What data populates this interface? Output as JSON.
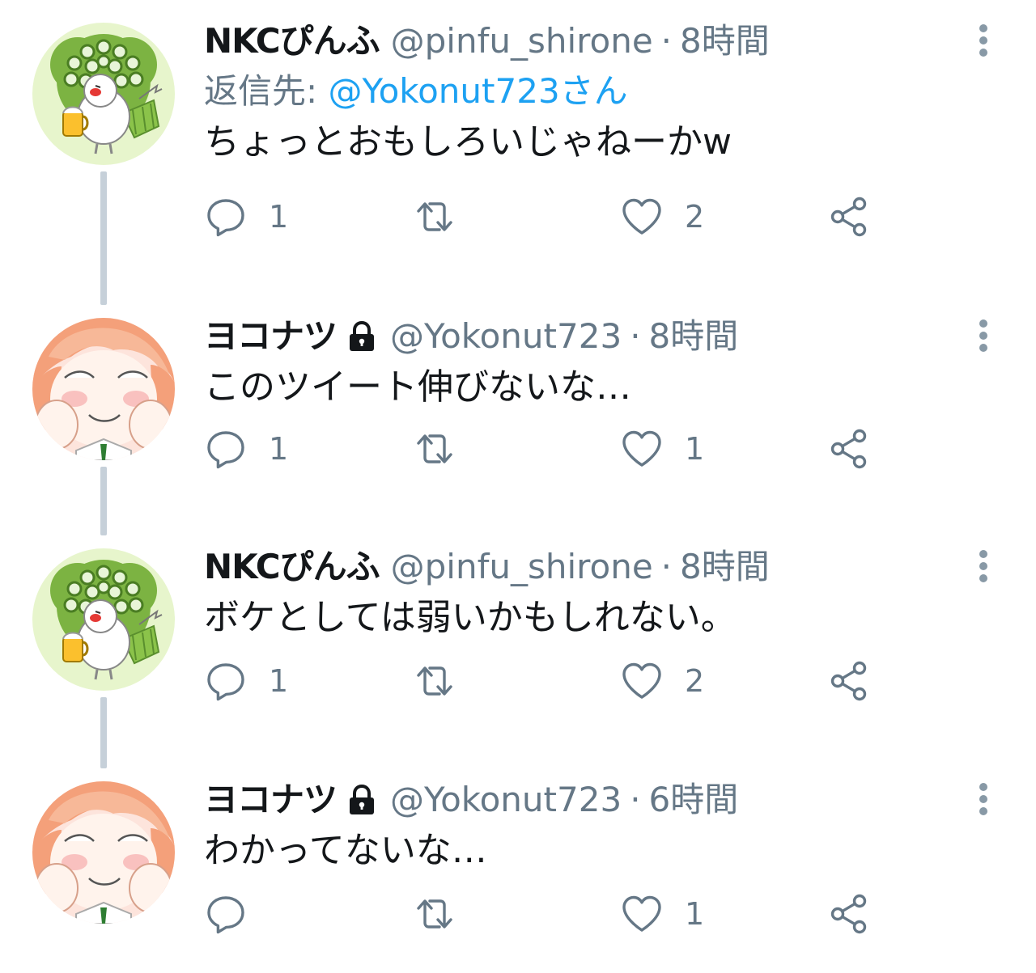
{
  "colors": {
    "secondary_text": "#657786",
    "link": "#1da1f2",
    "icon": "#657786",
    "thread_line": "#c6d0d9"
  },
  "icons": {
    "reply": "speech-bubble",
    "retweet": "retweet-arrows",
    "like": "heart",
    "share": "share-nodes",
    "lock": "padlock",
    "more": "vertical-ellipsis"
  },
  "tweets": [
    {
      "display_name": "NKCぴんふ",
      "protected": false,
      "handle": "@pinfu_shirone",
      "separator": "·",
      "time": "8時間",
      "reply_prefix": "返信先:",
      "reply_to": "@Yokonut723さん",
      "text": "ちょっとおもしろいじゃねーかw",
      "reply_count": "1",
      "retweet_count": "",
      "like_count": "2",
      "avatar": "peacock-bird-avatar"
    },
    {
      "display_name": "ヨコナツ",
      "protected": true,
      "handle": "@Yokonut723",
      "separator": "·",
      "time": "8時間",
      "text": "このツイート伸びないな…",
      "reply_count": "1",
      "retweet_count": "",
      "like_count": "1",
      "avatar": "anime-girl-avatar"
    },
    {
      "display_name": "NKCぴんふ",
      "protected": false,
      "handle": "@pinfu_shirone",
      "separator": "·",
      "time": "8時間",
      "text": "ボケとしては弱いかもしれない。",
      "reply_count": "1",
      "retweet_count": "",
      "like_count": "2",
      "avatar": "peacock-bird-avatar"
    },
    {
      "display_name": "ヨコナツ",
      "protected": true,
      "handle": "@Yokonut723",
      "separator": "·",
      "time": "6時間",
      "text": "わかってないな…",
      "reply_count": "",
      "retweet_count": "",
      "like_count": "1",
      "avatar": "anime-girl-avatar"
    }
  ]
}
